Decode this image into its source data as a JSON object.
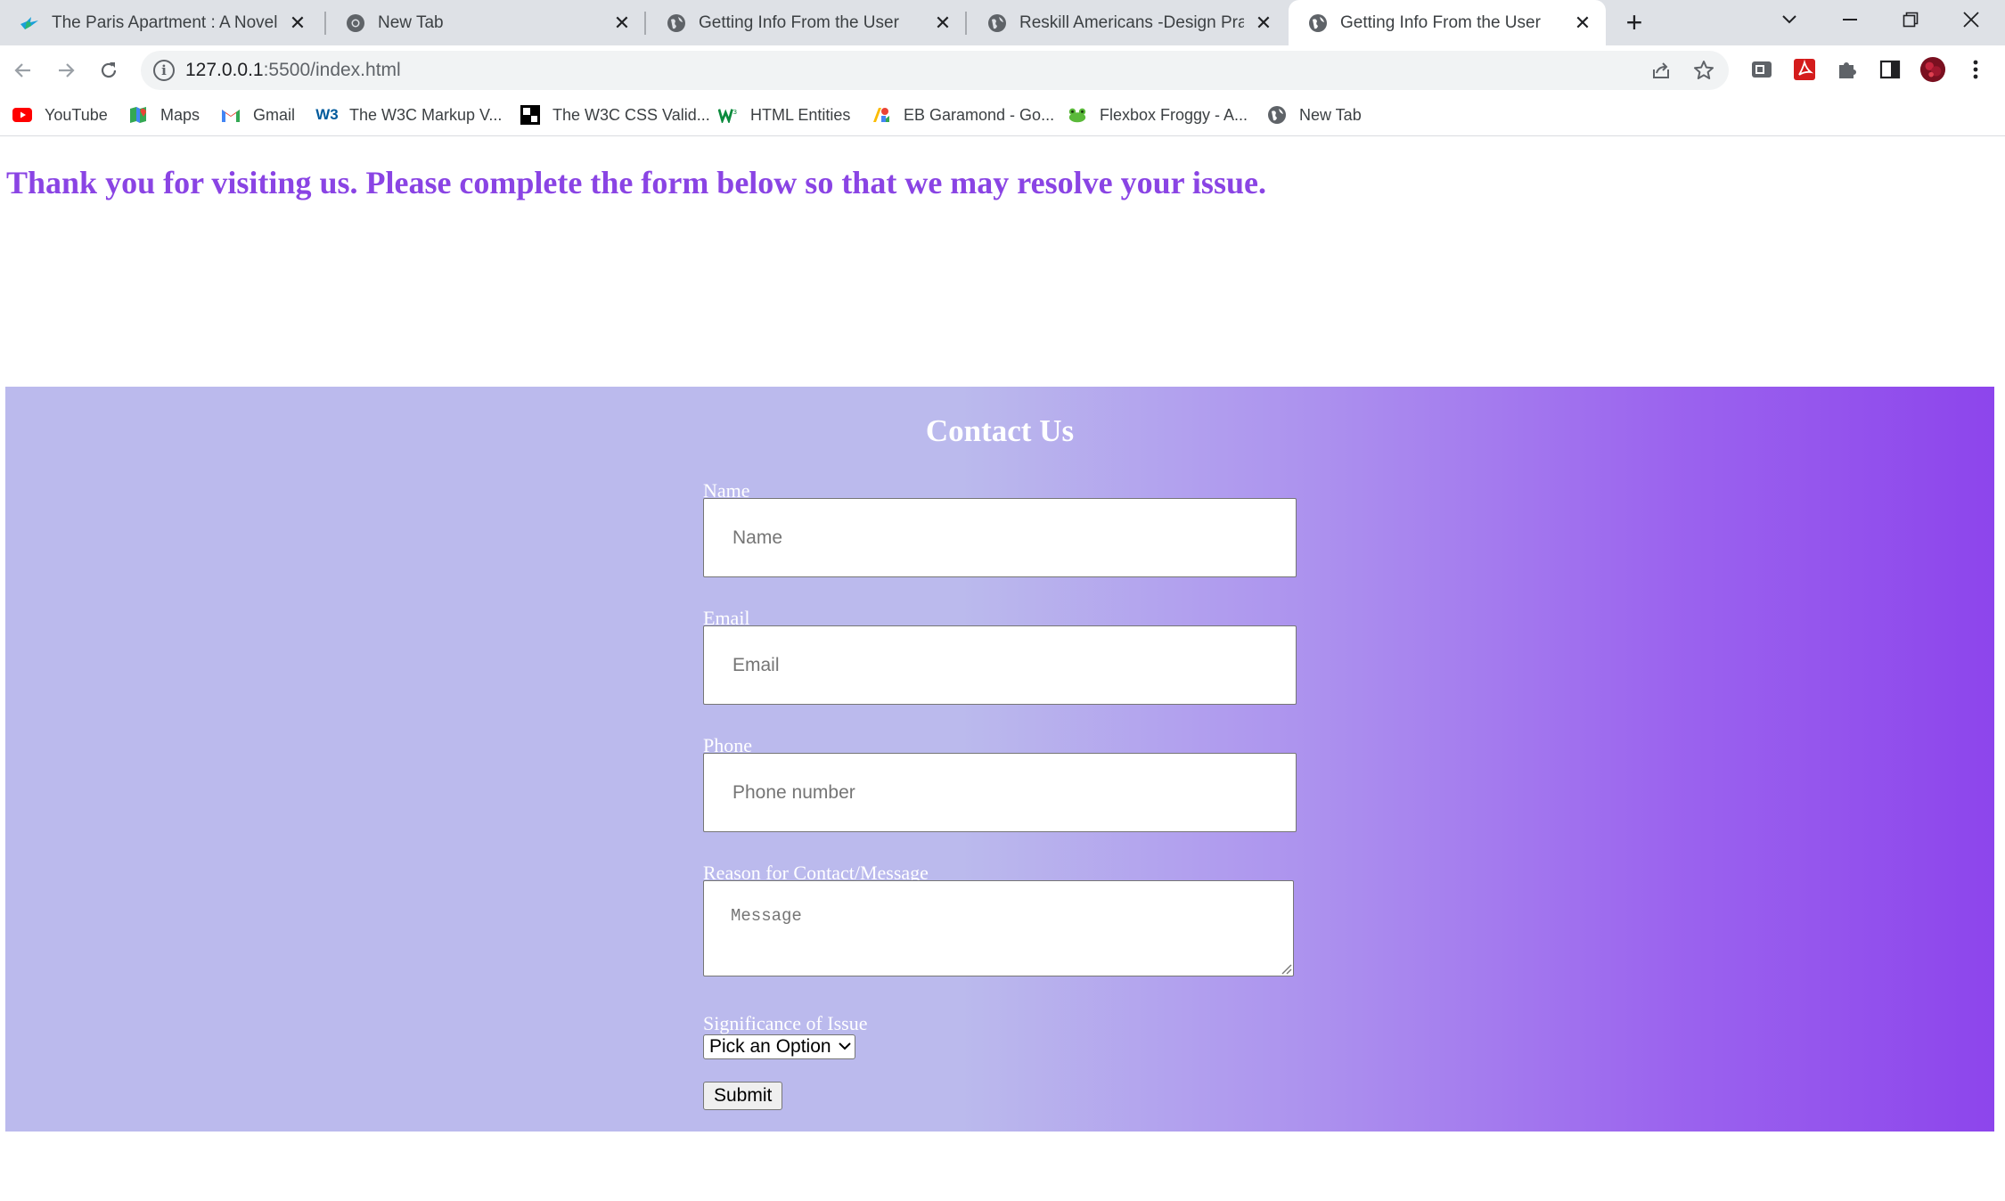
{
  "browser": {
    "tabs": [
      {
        "title": "The Paris Apartment : A Novel by",
        "icon": "bird-icon",
        "active": false
      },
      {
        "title": "New Tab",
        "icon": "chrome-icon",
        "active": false
      },
      {
        "title": "Getting Info From the User",
        "icon": "globe-icon",
        "active": false
      },
      {
        "title": "Reskill Americans -Design Practic",
        "icon": "globe-icon",
        "active": false
      },
      {
        "title": "Getting Info From the User",
        "icon": "globe-icon",
        "active": true
      }
    ],
    "new_tab_symbol": "+",
    "close_symbol": "✕",
    "url_host": "127.0.0.1",
    "url_path": ":5500/index.html",
    "bookmarks": [
      {
        "label": "YouTube",
        "icon": "youtube-icon"
      },
      {
        "label": "Maps",
        "icon": "maps-icon"
      },
      {
        "label": "Gmail",
        "icon": "gmail-icon"
      },
      {
        "label": "The W3C Markup V...",
        "icon": "w3c-icon"
      },
      {
        "label": "The W3C CSS Valid...",
        "icon": "w3c-css-icon"
      },
      {
        "label": "HTML Entities",
        "icon": "html-entities-icon"
      },
      {
        "label": "EB Garamond - Go...",
        "icon": "google-fonts-icon"
      },
      {
        "label": "Flexbox Froggy - A...",
        "icon": "frog-icon"
      },
      {
        "label": "New Tab",
        "icon": "globe-icon"
      }
    ]
  },
  "page": {
    "intro": "Thank you for visiting us. Please complete the form below so that we may resolve your issue.",
    "contact_title": "Contact Us",
    "form": {
      "name_label": "Name",
      "name_placeholder": "Name",
      "email_label": "Email",
      "email_placeholder": "Email",
      "phone_label": "Phone",
      "phone_placeholder": "Phone number",
      "message_label": "Reason for Contact/Message",
      "message_placeholder": "Message",
      "significance_label": "Significance of Issue",
      "significance_selected": "Pick an Option",
      "submit_label": "Submit"
    }
  },
  "colors": {
    "intro_text": "#8a44e4",
    "gradient_start": "#bbbaed",
    "gradient_end": "#8d45ec"
  }
}
